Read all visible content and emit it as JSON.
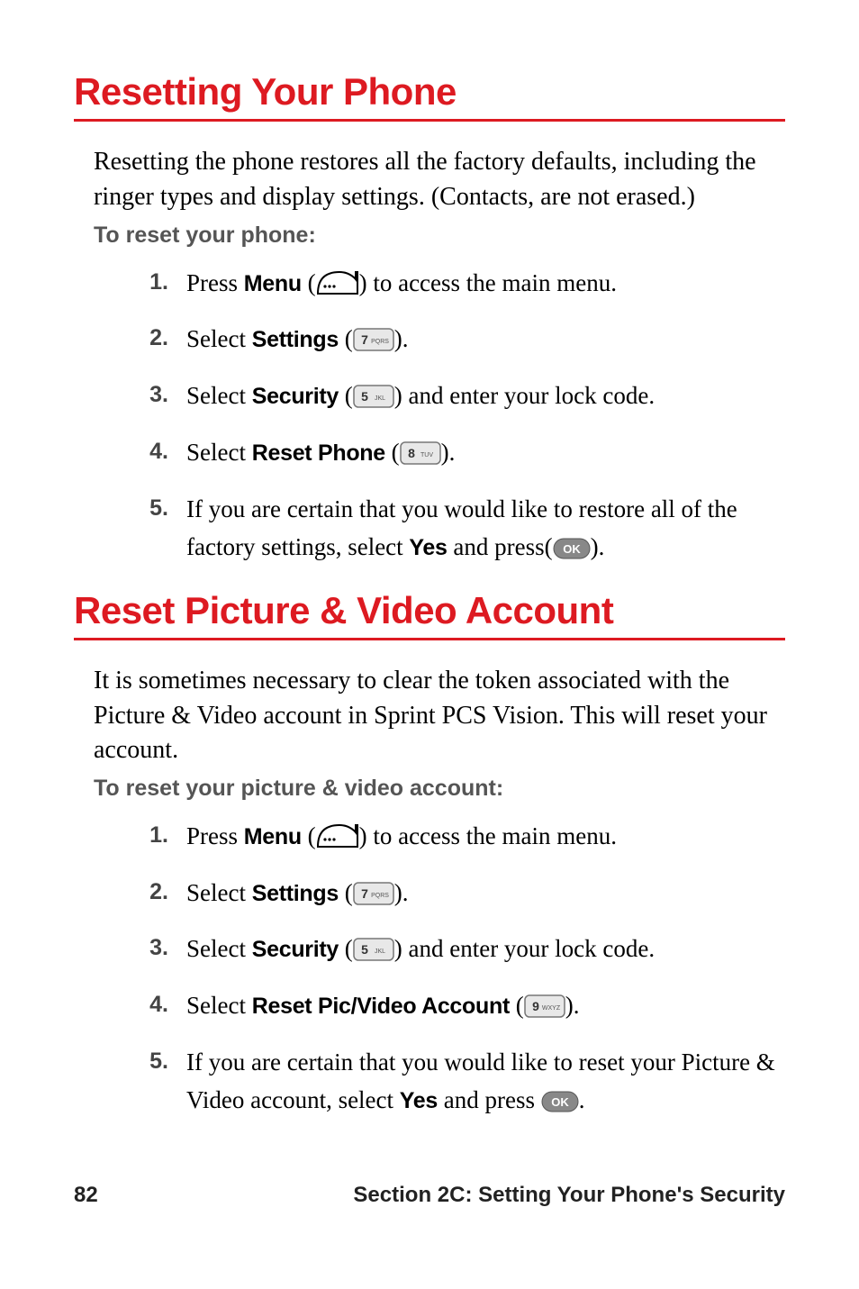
{
  "section1": {
    "title": "Resetting Your Phone",
    "intro": "Resetting the phone restores all the factory defaults, including the ringer types and display settings. (Contacts, are not erased.)",
    "subhead": "To reset your phone:",
    "steps": [
      {
        "n": "1.",
        "pre": "Press ",
        "label": "Menu",
        "post_a": " (",
        "post_b": ") to access the main menu.",
        "icon": "menu"
      },
      {
        "n": "2.",
        "pre": "Select ",
        "label": "Settings",
        "post_a": " (",
        "post_b": ").",
        "icon": "7pqrs"
      },
      {
        "n": "3.",
        "pre": "Select ",
        "label": "Security",
        "post_a": " (",
        "post_b": ") and enter your lock code.",
        "icon": "5jkl"
      },
      {
        "n": "4.",
        "pre": "Select ",
        "label": "Reset Phone",
        "post_a": " (",
        "post_b": ").",
        "icon": "8tuv"
      },
      {
        "n": "5.",
        "pre": "If you are certain that you would like to restore all of the factory settings, select ",
        "label": "Yes",
        "mid": " and press",
        "post_a": "(",
        "post_b": ").",
        "icon": "ok"
      }
    ]
  },
  "section2": {
    "title": "Reset Picture & Video Account",
    "intro": "It is sometimes necessary to clear the token associated with the Picture & Video account in Sprint PCS Vision. This will reset your account.",
    "subhead": "To reset your picture & video account:",
    "steps": [
      {
        "n": "1.",
        "pre": "Press ",
        "label": "Menu",
        "post_a": " (",
        "post_b": ") to access the main menu.",
        "icon": "menu"
      },
      {
        "n": "2.",
        "pre": "Select ",
        "label": "Settings",
        "post_a": " (",
        "post_b": ").",
        "icon": "7pqrs"
      },
      {
        "n": "3.",
        "pre": "Select ",
        "label": "Security",
        "post_a": " (",
        "post_b": ") and enter your lock code.",
        "icon": "5jkl"
      },
      {
        "n": "4.",
        "pre": "Select ",
        "label": "Reset Pic/Video Account",
        "post_a": " (",
        "post_b": ").",
        "icon": "9wxyz"
      },
      {
        "n": "5.",
        "pre": "If you are certain that you would like to reset your Picture & Video account, select ",
        "label": "Yes",
        "mid": " and press ",
        "post_a": "",
        "post_b": ".",
        "icon": "ok"
      }
    ]
  },
  "footer": {
    "page": "82",
    "section": "Section 2C: Setting Your Phone's Security"
  },
  "icons": {
    "menu": "menu-key-icon",
    "7pqrs": "key-7pqrs-icon",
    "5jkl": "key-5jkl-icon",
    "8tuv": "key-8tuv-icon",
    "9wxyz": "key-9wxyz-icon",
    "ok": "ok-key-icon"
  }
}
